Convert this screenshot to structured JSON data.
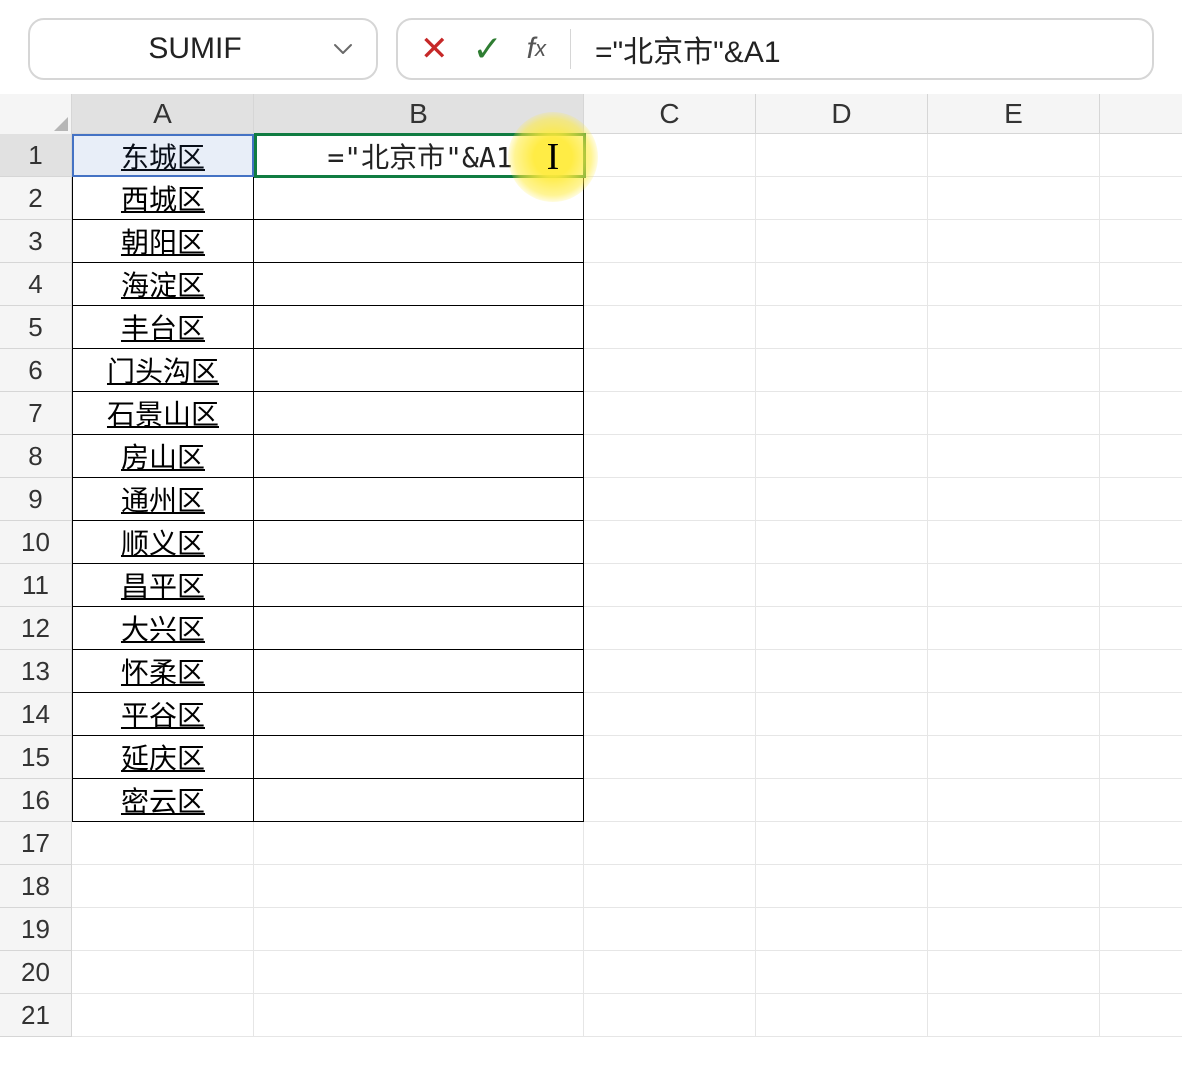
{
  "nameBox": {
    "value": "SUMIF"
  },
  "formulaBar": {
    "input": "=\"北京市\"&A1"
  },
  "columns": [
    "A",
    "B",
    "C",
    "D",
    "E"
  ],
  "rows": [
    {
      "num": 1,
      "A": "东城区",
      "B": "=\"北京市\"&A1",
      "active": true
    },
    {
      "num": 2,
      "A": "西城区",
      "B": ""
    },
    {
      "num": 3,
      "A": "朝阳区",
      "B": ""
    },
    {
      "num": 4,
      "A": "海淀区",
      "B": ""
    },
    {
      "num": 5,
      "A": "丰台区",
      "B": ""
    },
    {
      "num": 6,
      "A": "门头沟区",
      "B": ""
    },
    {
      "num": 7,
      "A": "石景山区",
      "B": ""
    },
    {
      "num": 8,
      "A": "房山区",
      "B": ""
    },
    {
      "num": 9,
      "A": "通州区",
      "B": ""
    },
    {
      "num": 10,
      "A": "顺义区",
      "B": ""
    },
    {
      "num": 11,
      "A": "昌平区",
      "B": ""
    },
    {
      "num": 12,
      "A": "大兴区",
      "B": ""
    },
    {
      "num": 13,
      "A": "怀柔区",
      "B": ""
    },
    {
      "num": 14,
      "A": "平谷区",
      "B": ""
    },
    {
      "num": 15,
      "A": "延庆区",
      "B": ""
    },
    {
      "num": 16,
      "A": "密云区",
      "B": ""
    },
    {
      "num": 17,
      "A": "",
      "B": "",
      "empty": true
    },
    {
      "num": 18,
      "A": "",
      "B": "",
      "empty": true
    },
    {
      "num": 19,
      "A": "",
      "B": "",
      "empty": true
    },
    {
      "num": 20,
      "A": "",
      "B": "",
      "empty": true
    },
    {
      "num": 21,
      "A": "",
      "B": "",
      "empty": true
    }
  ],
  "editCell": {
    "text": "=\"北京市\"&A1"
  }
}
